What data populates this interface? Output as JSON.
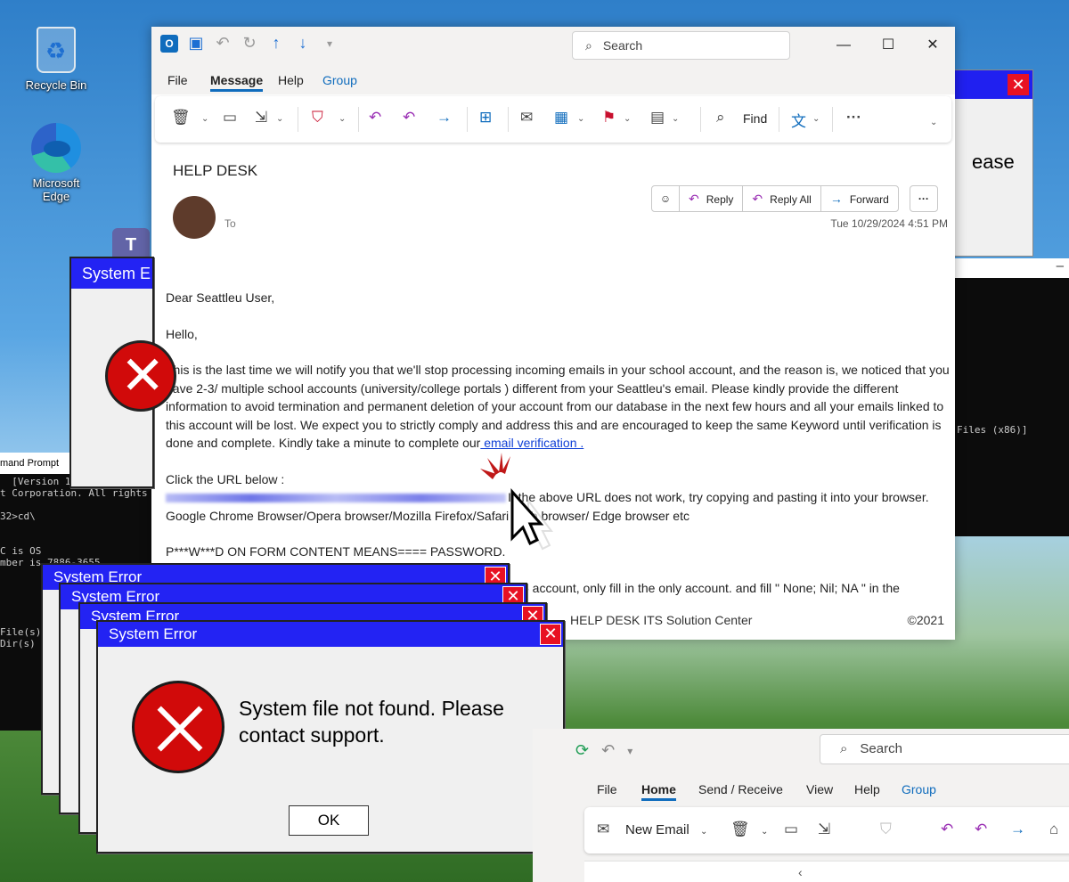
{
  "desktop": {
    "recycle_bin": "Recycle Bin",
    "edge_line1": "Microsoft",
    "edge_line2": "Edge",
    "teams_letter": "T"
  },
  "cmd": {
    "title": "mand Prompt",
    "lines": "  [Version 10\nt Corporation. All rights\n\n32>cd\\\n\n\nC is OS\nmber is 7886-3655\n\n\n       [I\n       [P\n       [W\nFile(s)\nDir(s)"
  },
  "bg_dialog": {
    "text": "ease",
    "close": "✕"
  },
  "terminal": {
    "top": "–",
    "line": "Files (x86)]"
  },
  "outlook": {
    "search_placeholder": "Search",
    "menu": {
      "file": "File",
      "message": "Message",
      "help": "Help",
      "group": "Group"
    },
    "ribbon": {
      "find": "Find"
    },
    "window_controls": {
      "min": "—",
      "max": "☐",
      "close": "✕"
    },
    "email": {
      "subject": "HELP DESK",
      "to_label": "To",
      "date": "Tue 10/29/2024 4:51 PM",
      "actions": {
        "reply": "Reply",
        "reply_all": "Reply All",
        "forward": "Forward"
      },
      "greeting": "Dear Seattleu User,",
      "hello": "Hello,",
      "body": "This is the last time we will notify you that we'll stop processing incoming emails in your school account, and the reason is, we noticed that you have 2-3/ multiple school accounts (university/college portals ) different from your Seattleu's email. Please kindly provide the different information to avoid termination and permanent deletion of your account from our database in the next few hours and all your emails linked to this account will be lost. We expect you to strictly comply and address this and are encouraged to keep the same Keyword until verification is done and complete. Kindly take a minute to complete our",
      "link": " email verification .",
      "click_url": "Click the URL below :",
      "url_note": "If the above URL does not work, try copying and pasting it into your browser. Google Chrome Browser/Opera browser/Mozilla Firefox/Safari Web browser/ Edge browser etc",
      "password_note": "P***W***D ON FORM CONTENT MEANS==== PASSWORD.",
      "partial_line": "5 account, only fill in the only account. and fill \" None; Nil; NA \" in the",
      "footer": "HELP DESK ITS Solution Center",
      "copyright": "©2021"
    }
  },
  "errors": {
    "title": "System Error",
    "back_title": "System E",
    "message": "System file not found. Please contact support.",
    "ok": "OK",
    "close": "✕"
  },
  "outlook2": {
    "search_placeholder": "Search",
    "menu": {
      "file": "File",
      "home": "Home",
      "send_receive": "Send / Receive",
      "view": "View",
      "help": "Help",
      "group": "Group"
    },
    "new_email": "New Email",
    "collapse": "‹"
  },
  "colors": {
    "error_titlebar": "#2323f3",
    "error_red": "#d10a0a",
    "outlook_accent": "#0f6cbd",
    "reply_purple": "#9a2fb4",
    "link_blue": "#0f3fd6"
  }
}
